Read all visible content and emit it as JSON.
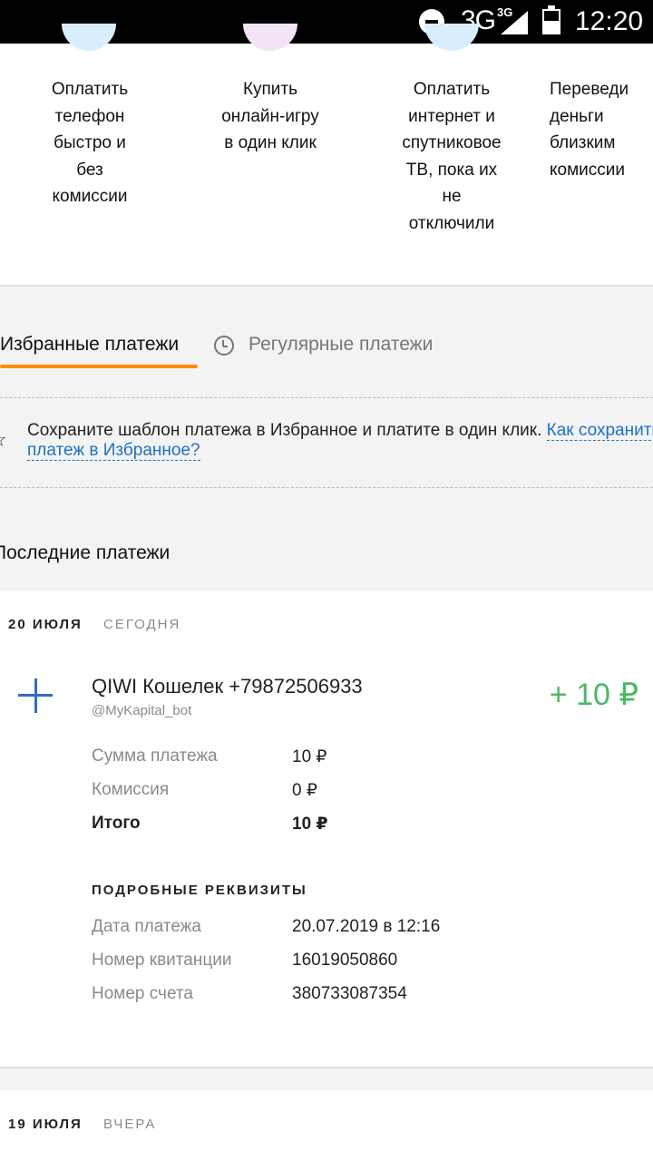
{
  "status_bar": {
    "network": "3G",
    "network_sup": "3G",
    "time": "12:20"
  },
  "quick_actions": [
    {
      "label": "Оплатить\nтелефон\nбыстро и\nбез\nкомиссии"
    },
    {
      "label": "Купить\nонлайн-игру\nв один клик"
    },
    {
      "label": "Оплатить\nинтернет и\nспутниковое\nТВ, пока их\nне\nотключили"
    },
    {
      "label": "Переведи\nденьги\nблизким\nкомиссии"
    }
  ],
  "tabs": {
    "favorites": "Избранные платежи",
    "regular": "Регулярные платежи"
  },
  "hint": {
    "text": "Сохраните шаблон платежа в Избранное и платите в один клик. ",
    "link": "Как сохранить платеж в Избранное?"
  },
  "section_title": "Последние платежи",
  "payments": [
    {
      "date": "20 ИЮЛЯ",
      "relative": "СЕГОДНЯ",
      "title": "QIWI Кошелек +79872506933",
      "subtitle": "@MyKapital_bot",
      "amount": "+ 10 ₽",
      "rows": [
        {
          "key": "Сумма платежа",
          "value": "10 ₽"
        },
        {
          "key": "Комиссия",
          "value": "0 ₽"
        },
        {
          "key": "Итого",
          "value": "10 ₽"
        }
      ],
      "details_heading": "ПОДРОБНЫЕ РЕКВИЗИТЫ",
      "details": [
        {
          "key": "Дата платежа",
          "value": "20.07.2019 в 12:16"
        },
        {
          "key": "Номер квитанции",
          "value": "16019050860"
        },
        {
          "key": "Номер счета",
          "value": "380733087354"
        }
      ]
    },
    {
      "date": "19 ИЮЛЯ",
      "relative": "ВЧЕРА"
    }
  ],
  "colors": {
    "accent_orange": "#ff8c00",
    "amount_green": "#4cb866",
    "icon_blue": "#2d6fc1",
    "link_blue": "#1a73c5"
  }
}
